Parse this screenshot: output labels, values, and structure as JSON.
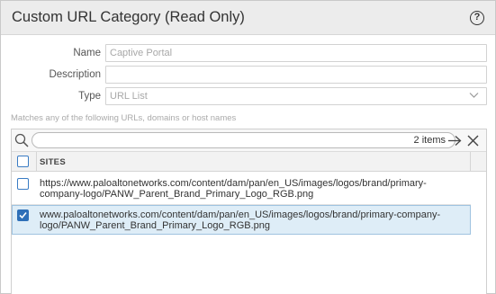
{
  "dialog": {
    "title": "Custom URL Category (Read Only)",
    "help_glyph": "?"
  },
  "form": {
    "name_label": "Name",
    "name_value": "Captive Portal",
    "description_label": "Description",
    "description_value": "",
    "type_label": "Type",
    "type_value": "URL List"
  },
  "hint": "Matches any of the following URLs, domains or host names",
  "search": {
    "placeholder": "",
    "count": "2 items"
  },
  "table": {
    "column_sites": "SITES",
    "rows": [
      {
        "line1": "https://www.paloaltonetworks.com/content/dam/pan/en_US/images/logos/brand/primary-",
        "line2": "company-logo/PANW_Parent_Brand_Primary_Logo_RGB.png",
        "checked": false
      },
      {
        "line1": "www.paloaltonetworks.com/content/dam/pan/en_US/images/logos/brand/primary-company-",
        "line2": "logo/PANW_Parent_Brand_Primary_Logo_RGB.png",
        "checked": true
      }
    ]
  },
  "colors": {
    "accent": "#2e6fb8",
    "selected_row": "#deedf7"
  }
}
